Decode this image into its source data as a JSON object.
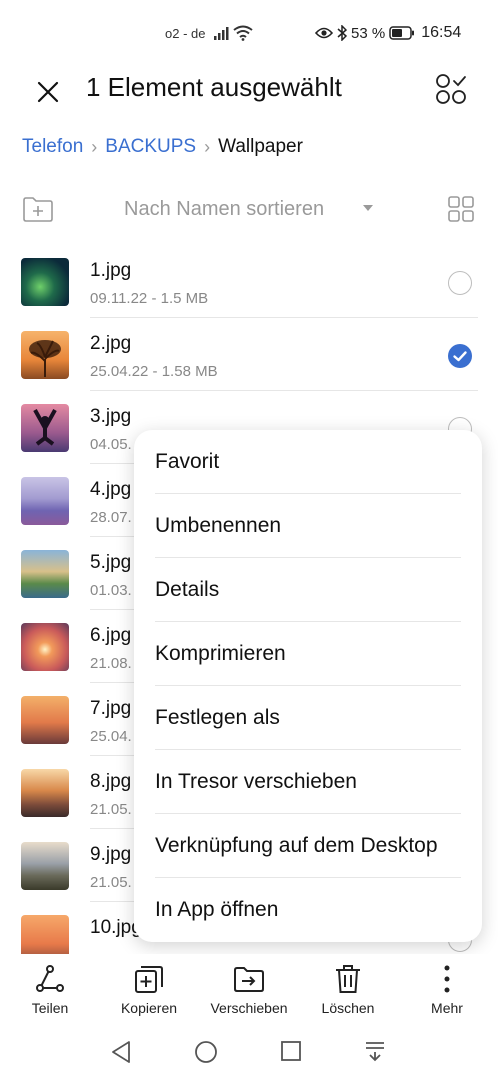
{
  "status_bar": {
    "carrier": "o2 - de",
    "battery_percent": "53 %",
    "time": "16:54"
  },
  "header": {
    "title": "1 Element ausgewählt"
  },
  "breadcrumb": {
    "items": [
      "Telefon",
      "BACKUPS",
      "Wallpaper"
    ]
  },
  "toolbar": {
    "sort_label": "Nach Namen sortieren"
  },
  "files": [
    {
      "name": "1.jpg",
      "meta": "09.11.22 - 1.5 MB",
      "selected": false
    },
    {
      "name": "2.jpg",
      "meta": "25.04.22 - 1.58 MB",
      "selected": true
    },
    {
      "name": "3.jpg",
      "meta": "04.05.",
      "selected": false
    },
    {
      "name": "4.jpg",
      "meta": "28.07.",
      "selected": false
    },
    {
      "name": "5.jpg",
      "meta": "01.03.",
      "selected": false
    },
    {
      "name": "6.jpg",
      "meta": "21.08.",
      "selected": false
    },
    {
      "name": "7.jpg",
      "meta": "25.04.",
      "selected": false
    },
    {
      "name": "8.jpg",
      "meta": "21.05.",
      "selected": false
    },
    {
      "name": "9.jpg",
      "meta": "21.05.",
      "selected": false
    },
    {
      "name": "10.jpg",
      "meta": "",
      "selected": false
    }
  ],
  "context_menu": {
    "items": [
      "Favorit",
      "Umbenennen",
      "Details",
      "Komprimieren",
      "Festlegen als",
      "In Tresor verschieben",
      "Verknüpfung auf dem Desktop",
      "In App öffnen"
    ]
  },
  "bottom_actions": {
    "share": "Teilen",
    "copy": "Kopieren",
    "move": "Verschieben",
    "delete": "Löschen",
    "more": "Mehr"
  },
  "colors": {
    "accent": "#3a6fd0"
  }
}
